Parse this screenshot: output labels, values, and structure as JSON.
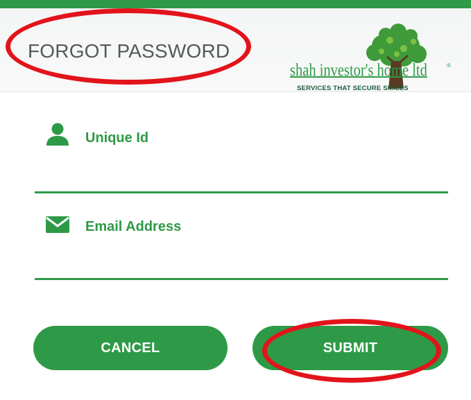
{
  "header": {
    "title": "FORGOT PASSWORD"
  },
  "logo": {
    "name": "shah investor's home ltd",
    "registered_mark": "®",
    "tagline": "SERVICES THAT SECURE SMILES"
  },
  "form": {
    "unique_id": {
      "label": "Unique Id",
      "value": "",
      "icon": "user-icon"
    },
    "email": {
      "label": "Email Address",
      "value": "",
      "icon": "envelope-icon"
    }
  },
  "buttons": {
    "cancel_label": "CANCEL",
    "submit_label": "SUBMIT"
  },
  "colors": {
    "brand_green": "#2e9a47",
    "annotation_red": "#e3131b",
    "title_gray": "#555a57"
  }
}
